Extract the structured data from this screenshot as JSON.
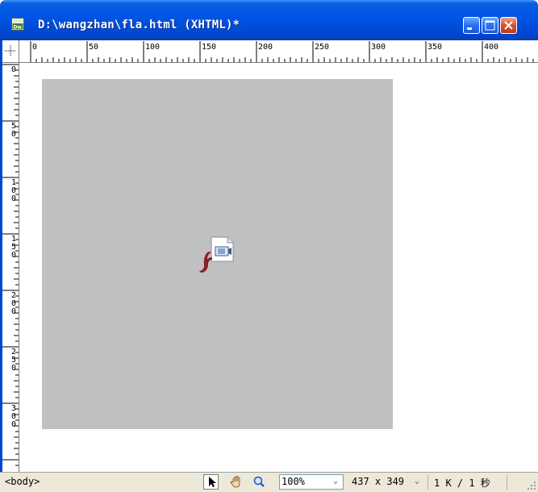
{
  "window": {
    "title": "D:\\wangzhan\\fla.html (XHTML)*",
    "app_icon": "dreamweaver-icon",
    "buttons": [
      "minimize",
      "maximize",
      "close"
    ]
  },
  "ruler": {
    "horizontal_labels": [
      "0",
      "50",
      "100",
      "150",
      "200",
      "250",
      "300",
      "350",
      "400"
    ],
    "vertical_labels": [
      "0",
      "50",
      "100",
      "150",
      "200",
      "250",
      "300"
    ]
  },
  "document": {
    "placeholder": "flash-object-placeholder",
    "placeholder_icon": "flash-file-icon",
    "placeholder_color": "#c0c0c0"
  },
  "statusbar": {
    "tag_selector": "<body>",
    "tools": [
      "pointer-tool-icon",
      "hand-tool-icon",
      "zoom-tool-icon"
    ],
    "zoom": "100%",
    "window_size": "437 x 349",
    "doc_size": "1 K / 1 秒"
  },
  "colors": {
    "titlebar": "#0055e5",
    "statusbar": "#ece9d8"
  }
}
